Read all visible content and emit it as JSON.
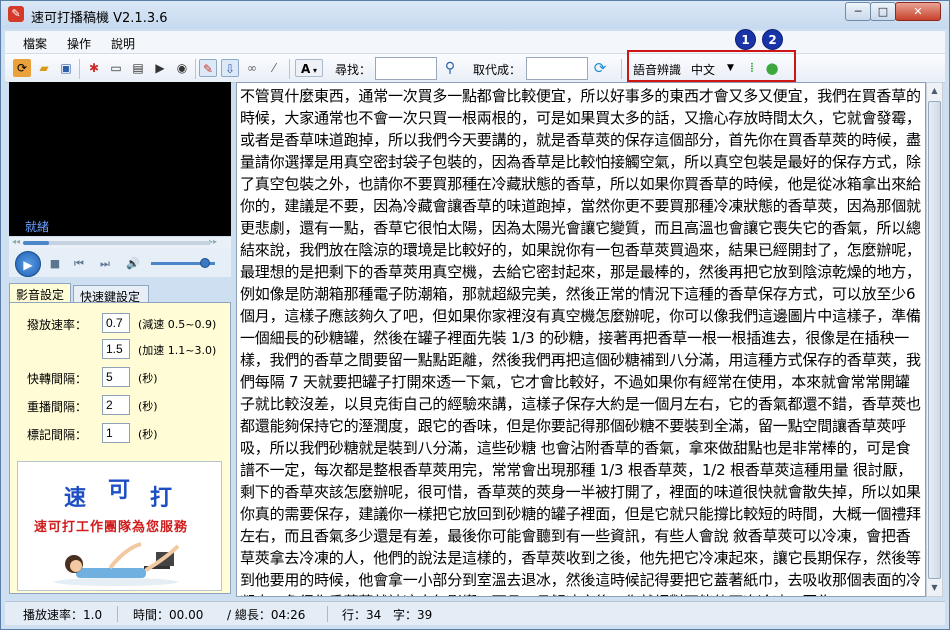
{
  "window": {
    "title": "速可打播稿機 V2.1.3.6",
    "controls": {
      "minimize": "─",
      "maximize": "□",
      "close": "✕"
    }
  },
  "menu": [
    "檔案",
    "操作",
    "說明"
  ],
  "toolbar": {
    "font_button": "A",
    "find_label": "尋找：",
    "find_value": "",
    "replace_label": "取代成：",
    "replace_value": "",
    "voice_label": "語音辨識",
    "voice_language": "中文",
    "badges": [
      "1",
      "2"
    ]
  },
  "player": {
    "status": "就緒",
    "seek_progress": 0.14,
    "volume_level": 0.85
  },
  "tabs": [
    "影音設定",
    "快速鍵設定"
  ],
  "settings": {
    "speed_label": "撥放速率：",
    "slow_value": "0.7",
    "slow_note": "(減速 0.5~0.9)",
    "fast_value": "1.5",
    "fast_note": "(加速 1.1~3.0)",
    "ff_label": "快轉間隔：",
    "ff_value": "5",
    "rewind_label": "重播間隔：",
    "rewind_value": "2",
    "mark_label": "標記間隔：",
    "mark_value": "1",
    "unit": "(秒)"
  },
  "promo": {
    "logo_chars": [
      "速",
      "可",
      "打"
    ],
    "slogan": "速可打工作團隊為您服務"
  },
  "transcript": "不管買什麼東西，通常一次買多一點都會比較便宜，所以好事多的東西才會又多又便宜，我們在買香草的時候，大家通常也不會一次只買一根兩根的，可是如果買太多的話，又擔心存放時間太久，它就會發霉，或者是香草味道跑掉，所以我們今天要講的，就是香草莢的保存這個部分，首先你在買香草莢的時候，盡量請你選擇是用真空密封袋子包裝的，因為香草是比較怕接觸空氣，所以真空包裝是最好的保存方式，除了真空包裝之外，也請你不要買那種在冷藏狀態的香草，所以如果你買香草的時候，他是從冰箱拿出來給你的，建議是不要，因為冷藏會讓香草的味道跑掉，當然你更不要買那種冷凍狀態的香草莢，因為那個就更悲劇，還有一點，香草它很怕太陽，因為太陽光會讓它變質，而且高溫也會讓它喪失它的香氣，所以總結來說，我們放在陰涼的環境是比較好的，如果說你有一包香草莢買過來，結果已經開封了，怎麼辦呢，最理想的是把剩下的香草莢用真空機，去給它密封起來，那是最棒的，然後再把它放到陰涼乾燥的地方，例如像是防潮箱那種電子防潮箱，那就超級完美，然後正常的情況下這種的香草保存方式，可以放至少6 個月，這樣子應該夠久了吧，但如果你家裡沒有真空機怎麼辦呢，你可以像我們這邊圖片中這樣子，準備一個細長的砂糖罐，然後在罐子裡面先裝 1/3 的砂糖，接著再把香草一根一根插進去，很像是在插秧一樣，我們的香草之間要留一點點距離，然後我們再把這個砂糖補到八分滿，用這種方式保存的香草莢，我們每隔 7 天就要把罐子打開來透一下氣，它才會比較好，不過如果你有經常在使用，本來就會常常開罐子就比較沒差，以貝克街自己的經驗來講，這樣子保存大約是一個月左右，它的香氣都還不錯，香草莢也都還能夠保持它的溼潤度，跟它的香味，但是你要記得那個砂糖不要裝到全滿，留一點空間讓香草莢呼吸，所以我們砂糖就是裝到八分滿，這些砂糖 也會沾附香草的香氣，拿來做甜點也是非常棒的，可是食譜不一定，每次都是整根香草莢用完，常常會出現那種 1/3 根香草莢，1/2 根香草莢這種用量 很討厭，剩下的香草夾該怎麼辦呢，很可惜，香草莢的莢身一半被打開了，裡面的味道很快就會散失掉，所以如果你真的需要保存，建議你一樣把它放回到砂糖的罐子裡面，但是它就只能撐比較短的時間，大概一個禮拜左右，而且香氣多少還是有差，最後你可能會聽到有一些資訊，有些人會說 敘香草莢可以冷凍，會把香草莢拿去冷凍的人，他們的說法是這樣的，香草莢收到之後，他先把它冷凍起來，讓它長期保存，然後等到他要用的時候，他會拿一小部分到室溫去退冰，然後這時候記得要把它蓋著紙巾，去吸收那個表面的冷凝水，免得你香草莢就被這水氣影響，而且一旦解凍之後，你就絕對不能夠再次冷凍，因為",
  "status": {
    "speed": "播放速率：1.0",
    "time": "時間：00.00",
    "total": "/ 總長：04:26",
    "row": "行：34",
    "char": "字：39"
  }
}
